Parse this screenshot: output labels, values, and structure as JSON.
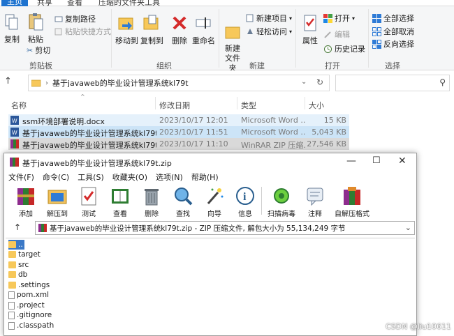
{
  "explorer": {
    "tabs": [
      "主页",
      "共享",
      "查看",
      "压缩的文件夹工具"
    ],
    "ribbon": {
      "clipboard": {
        "label": "剪贴板",
        "copy": "复制",
        "paste": "粘贴",
        "copy_path": "复制路径",
        "paste_shortcut": "粘贴快捷方式",
        "cut": "剪切"
      },
      "organize": {
        "label": "组织",
        "move_to": "移动到",
        "copy_to": "复制到",
        "delete": "删除",
        "rename": "重命名"
      },
      "new": {
        "label": "新建",
        "new_folder": "新建\n文件夹",
        "new_item": "新建项目",
        "easy_access": "轻松访问"
      },
      "open": {
        "label": "打开",
        "properties": "属性",
        "open": "打开",
        "edit": "编辑",
        "history": "历史记录"
      },
      "select": {
        "label": "选择",
        "select_all": "全部选择",
        "select_none": "全部取消",
        "invert": "反向选择"
      }
    },
    "address": "基于javaweb的毕业设计管理系统kl79t",
    "columns": {
      "name": "名称",
      "modified": "修改日期",
      "type": "类型",
      "size": "大小"
    },
    "files": [
      {
        "name": "ssm环境部署说明.docx",
        "date": "2023/10/17 12:01",
        "type": "Microsoft Word ...",
        "size": "15 KB"
      },
      {
        "name": "基于javaweb的毕业设计管理系统kl79t....",
        "date": "2023/10/17 11:51",
        "type": "Microsoft Word ...",
        "size": "5,043 KB"
      },
      {
        "name": "基于javaweb的毕业设计管理系统kl79t.z...",
        "date": "2023/10/17 11:10",
        "type": "WinRAR ZIP 压缩...",
        "size": "27,546 KB"
      }
    ]
  },
  "winrar": {
    "title": "基于javaweb的毕业设计管理系统kl79t.zip",
    "menu": [
      "文件(F)",
      "命令(C)",
      "工具(S)",
      "收藏夹(O)",
      "选项(N)",
      "帮助(H)"
    ],
    "tools": [
      "添加",
      "解压到",
      "测试",
      "查看",
      "删除",
      "查找",
      "向导",
      "信息",
      "扫描病毒",
      "注释",
      "自解压格式"
    ],
    "path": "基于javaweb的毕业设计管理系统kl79t.zip - ZIP 压缩文件, 解包大小为 55,134,249 字节",
    "items": [
      {
        "name": "..",
        "kind": "folder"
      },
      {
        "name": "target",
        "kind": "folder"
      },
      {
        "name": "src",
        "kind": "folder"
      },
      {
        "name": "db",
        "kind": "folder"
      },
      {
        "name": ".settings",
        "kind": "folder"
      },
      {
        "name": "pom.xml",
        "kind": "file"
      },
      {
        "name": ".project",
        "kind": "file"
      },
      {
        "name": ".gitignore",
        "kind": "file"
      },
      {
        "name": ".classpath",
        "kind": "file"
      }
    ]
  },
  "watermark": "CSDN @liu10611",
  "colors": {
    "accent": "#1e73cf",
    "selection": "#cce4f7",
    "folder": "#f7c85a"
  }
}
